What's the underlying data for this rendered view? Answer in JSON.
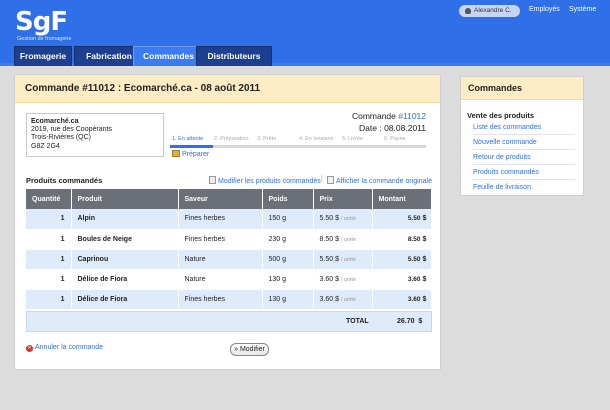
{
  "app": {
    "logo": "SgF",
    "subtitle": "Gestion de fromagerie"
  },
  "topnav": {
    "user": "Alexandre C.",
    "links": [
      "Employés",
      "Système"
    ]
  },
  "tabs": [
    {
      "label": "Fromagerie",
      "active": false
    },
    {
      "label": "Fabrication",
      "active": false
    },
    {
      "label": "Commandes",
      "active": true
    },
    {
      "label": "Distributeurs",
      "active": false
    }
  ],
  "order": {
    "title": "Commande #11012 : Ecomarché.ca - 08 août 2011",
    "ref_label": "Commande",
    "ref_num": "#11012",
    "date_label": "Date :",
    "date": "08.08.2011",
    "address": [
      "Ecomarché.ca",
      "2019, rue des Coopérants",
      "Trois-Rivières (QC)",
      "G8Z 2G4"
    ],
    "steps": [
      "1. En attente",
      "2. Préparation",
      "3. Prête",
      "4. En livraison",
      "5. Livrée",
      "6. Payée"
    ],
    "progress_fraction": 0.167,
    "prepare_link": "Préparer"
  },
  "products": {
    "section_title": "Produits commandés",
    "edit_link": "Modifier les produits commandés",
    "separator": "|",
    "original_link": "Afficher la commande originale",
    "columns": [
      "Quantité",
      "Produit",
      "Saveur",
      "Poids",
      "Prix",
      "Montant"
    ],
    "rows": [
      {
        "qty": "1",
        "product": "Alpin",
        "flavor": "Fines herbes",
        "weight": "150 g",
        "price": "5.50 $",
        "unit": "/ unité",
        "amount": "5.50",
        "cur": "$"
      },
      {
        "qty": "1",
        "product": "Boules de Neige",
        "flavor": "Fines herbes",
        "weight": "230 g",
        "price": "8.50 $",
        "unit": "/ unité",
        "amount": "8.50",
        "cur": "$"
      },
      {
        "qty": "1",
        "product": "Caprinou",
        "flavor": "Nature",
        "weight": "500 g",
        "price": "5.50 $",
        "unit": "/ unité",
        "amount": "5.50",
        "cur": "$"
      },
      {
        "qty": "1",
        "product": "Délice de Fiora",
        "flavor": "Nature",
        "weight": "130 g",
        "price": "3.60 $",
        "unit": "/ unité",
        "amount": "3.60",
        "cur": "$"
      },
      {
        "qty": "1",
        "product": "Délice de Fiora",
        "flavor": "Fines herbes",
        "weight": "130 g",
        "price": "3.60 $",
        "unit": "/ unité",
        "amount": "3.60",
        "cur": "$"
      }
    ],
    "total_label": "TOTAL",
    "total": "26.70",
    "total_cur": "$"
  },
  "actions": {
    "cancel": "Annuler la commande",
    "modify": "» Modifier"
  },
  "sidebar": {
    "title": "Commandes",
    "section": "Vente des produits",
    "items": [
      "Liste des commandes",
      "Nouvelle commande",
      "Retour de produits",
      "Produits commandés",
      "Feuille de livraison"
    ]
  },
  "colors": {
    "brand_blue": "#2f6fe8",
    "tab_dark": "#1d3f8f",
    "header_peach": "#fdecc4",
    "table_head": "#6a6f78",
    "row_alt": "#deebfb"
  }
}
